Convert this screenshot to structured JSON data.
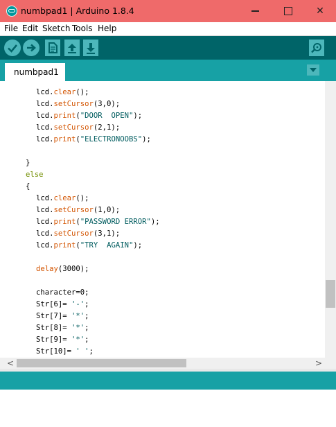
{
  "window": {
    "title": "numbpad1 | Arduino 1.8.4",
    "minimize_glyph": "",
    "close_glyph": "✕"
  },
  "menu": {
    "items": [
      "File",
      "Edit",
      "Sketch",
      "Tools",
      "Help"
    ]
  },
  "toolbar": {
    "buttons": [
      {
        "name": "verify-button",
        "icon": "check-icon"
      },
      {
        "name": "upload-button",
        "icon": "arrow-right-icon"
      },
      {
        "name": "new-button",
        "icon": "document-icon"
      },
      {
        "name": "open-button",
        "icon": "arrow-up-icon"
      },
      {
        "name": "save-button",
        "icon": "arrow-down-icon"
      },
      {
        "name": "serial-monitor-button",
        "icon": "magnifier-icon"
      }
    ]
  },
  "tabs": {
    "active": "numbpad1",
    "menu_icon": "triangle-down-icon"
  },
  "colors": {
    "titlebar": "#ef6a6a",
    "toolbar": "#006468",
    "tabbar": "#17a1a5",
    "button": "#4db7bb",
    "function": "#d35400",
    "keyword": "#728e00",
    "string": "#005c5f"
  },
  "code": {
    "lines": [
      [
        [
          "lcd.",
          "p"
        ],
        [
          "clear",
          "f"
        ],
        [
          "();",
          "p"
        ]
      ],
      [
        [
          "lcd.",
          "p"
        ],
        [
          "setCursor",
          "f"
        ],
        [
          "(3,0);",
          "p"
        ]
      ],
      [
        [
          "lcd.",
          "p"
        ],
        [
          "print",
          "f"
        ],
        [
          "(",
          "p"
        ],
        [
          "\"DOOR  OPEN\"",
          "s"
        ],
        [
          ");",
          "p"
        ]
      ],
      [
        [
          "lcd.",
          "p"
        ],
        [
          "setCursor",
          "f"
        ],
        [
          "(2,1);",
          "p"
        ]
      ],
      [
        [
          "lcd.",
          "p"
        ],
        [
          "print",
          "f"
        ],
        [
          "(",
          "p"
        ],
        [
          "\"ELECTRONOOBS\"",
          "s"
        ],
        [
          ");",
          "p"
        ]
      ],
      [],
      [
        [
          "}",
          "p"
        ]
      ],
      [
        [
          "else",
          "k"
        ]
      ],
      [
        [
          "{",
          "p"
        ]
      ],
      [
        [
          "lcd.",
          "p"
        ],
        [
          "clear",
          "f"
        ],
        [
          "();",
          "p"
        ]
      ],
      [
        [
          "lcd.",
          "p"
        ],
        [
          "setCursor",
          "f"
        ],
        [
          "(1,0);",
          "p"
        ]
      ],
      [
        [
          "lcd.",
          "p"
        ],
        [
          "print",
          "f"
        ],
        [
          "(",
          "p"
        ],
        [
          "\"PASSWORD ERROR\"",
          "s"
        ],
        [
          ");",
          "p"
        ]
      ],
      [
        [
          "lcd.",
          "p"
        ],
        [
          "setCursor",
          "f"
        ],
        [
          "(3,1);",
          "p"
        ]
      ],
      [
        [
          "lcd.",
          "p"
        ],
        [
          "print",
          "f"
        ],
        [
          "(",
          "p"
        ],
        [
          "\"TRY  AGAIN\"",
          "s"
        ],
        [
          ");",
          "p"
        ]
      ],
      [],
      [
        [
          "delay",
          "f"
        ],
        [
          "(3000);",
          "p"
        ]
      ],
      [],
      [
        [
          "character=0;",
          "p"
        ]
      ],
      [
        [
          "Str[6]= ",
          "p"
        ],
        [
          "'-'",
          "s"
        ],
        [
          ";",
          "p"
        ]
      ],
      [
        [
          "Str[7]= ",
          "p"
        ],
        [
          "'*'",
          "s"
        ],
        [
          ";",
          "p"
        ]
      ],
      [
        [
          "Str[8]= ",
          "p"
        ],
        [
          "'*'",
          "s"
        ],
        [
          ";",
          "p"
        ]
      ],
      [
        [
          "Str[9]= ",
          "p"
        ],
        [
          "'*'",
          "s"
        ],
        [
          ";",
          "p"
        ]
      ],
      [
        [
          "Str[10]= ",
          "p"
        ],
        [
          "' '",
          "s"
        ],
        [
          ";",
          "p"
        ]
      ]
    ],
    "indents": [
      2,
      2,
      2,
      2,
      2,
      0,
      1,
      1,
      1,
      2,
      2,
      2,
      2,
      2,
      0,
      2,
      0,
      2,
      2,
      2,
      2,
      2,
      2
    ]
  },
  "scrollbars": {
    "left_arrow": "<",
    "right_arrow": ">"
  }
}
